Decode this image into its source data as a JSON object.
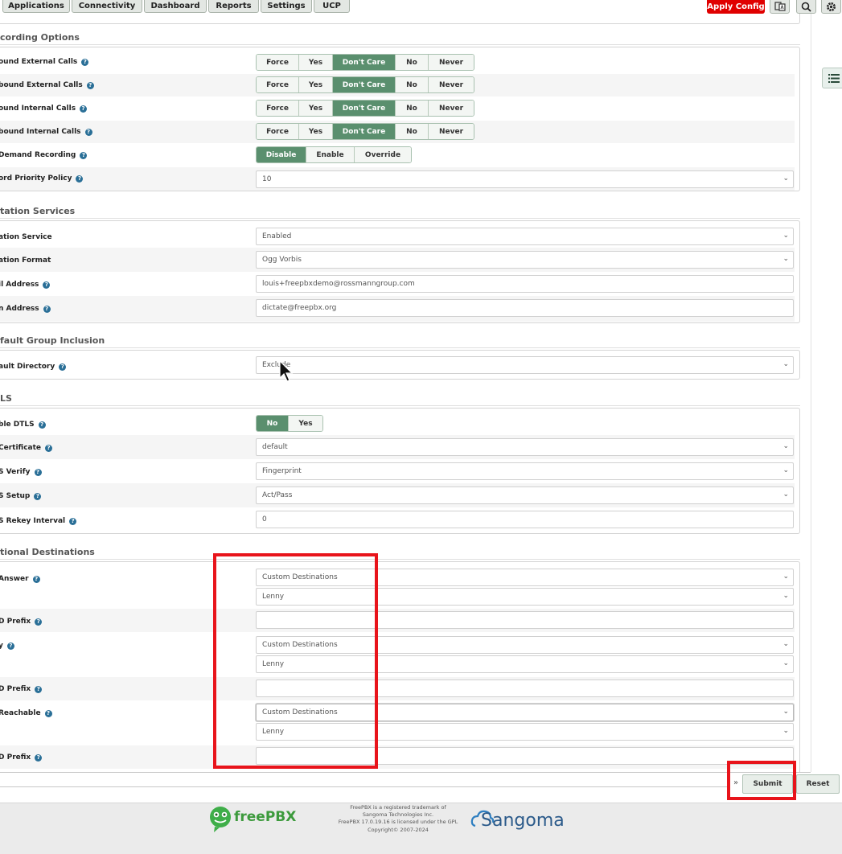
{
  "nav": {
    "tabs": [
      "Applications",
      "Connectivity",
      "Dashboard",
      "Reports",
      "Settings",
      "UCP"
    ],
    "apply_config": "Apply Config"
  },
  "sections": {
    "recording": {
      "title": "cording Options",
      "rows": [
        {
          "label": "ound External Calls",
          "options": [
            "Force",
            "Yes",
            "Don't Care",
            "No",
            "Never"
          ],
          "selected": "Don't Care"
        },
        {
          "label": "bound External Calls",
          "options": [
            "Force",
            "Yes",
            "Don't Care",
            "No",
            "Never"
          ],
          "selected": "Don't Care"
        },
        {
          "label": "ound Internal Calls",
          "options": [
            "Force",
            "Yes",
            "Don't Care",
            "No",
            "Never"
          ],
          "selected": "Don't Care"
        },
        {
          "label": "bound Internal Calls",
          "options": [
            "Force",
            "Yes",
            "Don't Care",
            "No",
            "Never"
          ],
          "selected": "Don't Care"
        },
        {
          "label": "Demand Recording",
          "options": [
            "Disable",
            "Enable",
            "Override"
          ],
          "selected": "Disable"
        }
      ],
      "priority_label": "ord Priority Policy",
      "priority_value": "10"
    },
    "dictation": {
      "title": "tation Services",
      "service_label": "ation Service",
      "service_value": "Enabled",
      "format_label": "ation Format",
      "format_value": "Ogg Vorbis",
      "email_label": "il Address",
      "email_value": "louis+freepbxdemo@rossmanngroup.com",
      "from_label": "n Address",
      "from_value": "dictate@freepbx.org"
    },
    "group": {
      "title": "fault Group Inclusion",
      "dir_label": "ault Directory",
      "dir_value": "Exclude"
    },
    "dtls": {
      "title": "LS",
      "enable_label": "ble DTLS",
      "enable_options": [
        "No",
        "Yes"
      ],
      "enable_selected": "No",
      "cert_label": "Certificate",
      "cert_value": "default",
      "verify_label": "S Verify",
      "verify_value": "Fingerprint",
      "setup_label": "S Setup",
      "setup_value": "Act/Pass",
      "rekey_label": "S Rekey Interval",
      "rekey_value": "0"
    },
    "optional": {
      "title": "tional Destinations",
      "noanswer_label": "Answer",
      "noanswer_dest": "Custom Destinations",
      "noanswer_target": "Lenny",
      "cid1_label": "D Prefix",
      "busy_label": "y",
      "busy_dest": "Custom Destinations",
      "busy_target": "Lenny",
      "cid2_label": "D Prefix",
      "unreach_label": "Reachable",
      "unreach_dest": "Custom Destinations",
      "unreach_target": "Lenny",
      "cid3_label": "D Prefix"
    }
  },
  "actions": {
    "submit": "Submit",
    "reset": "Reset",
    "expand": "»"
  },
  "footer": {
    "brand": "freePBX",
    "legal": [
      "FreePBX is a registered trademark of",
      "Sangoma Technologies Inc.",
      "FreePBX 17.0.19.16 is licensed under the GPL",
      "Copyright© 2007-2024"
    ],
    "company": "Sangoma"
  },
  "colors": {
    "active_segment": "#5a8f6e",
    "apply_config": "#e00000",
    "annotation": "#e8141b"
  }
}
